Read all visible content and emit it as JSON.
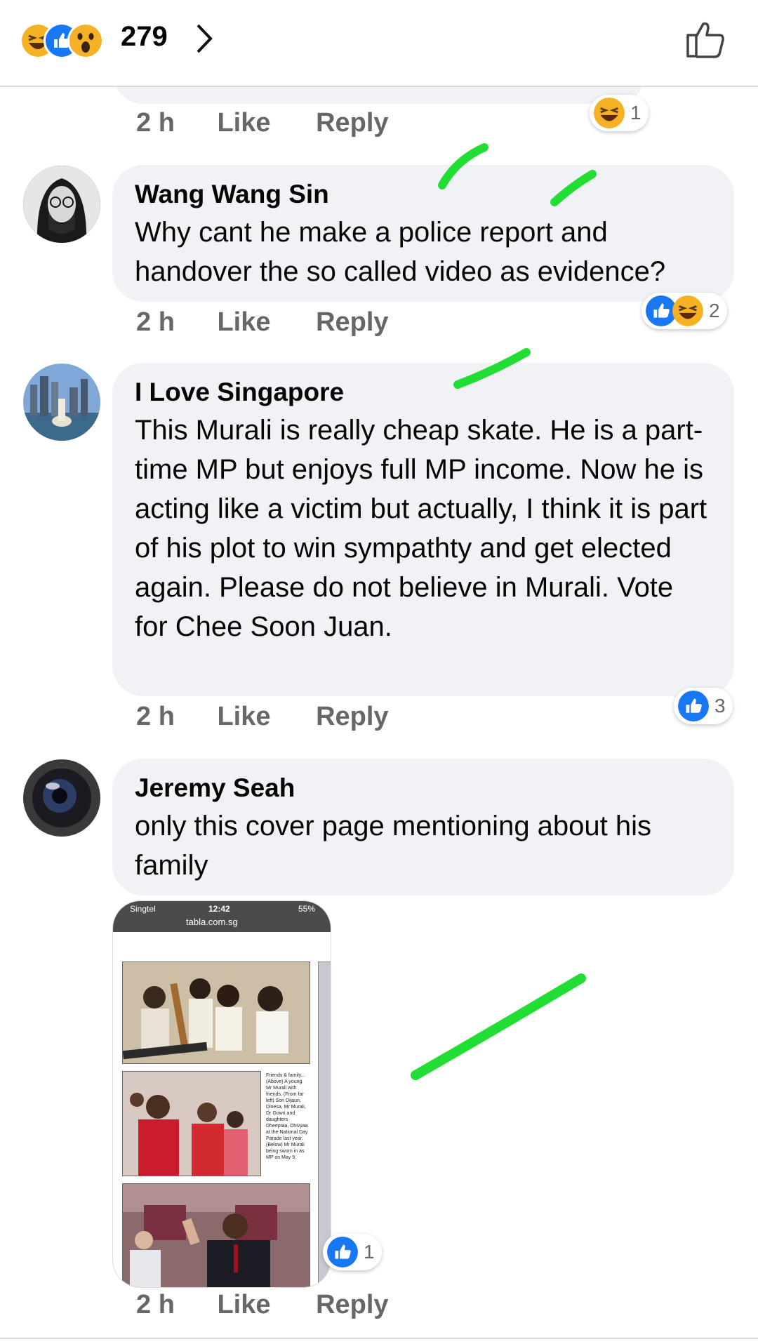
{
  "header": {
    "reaction_count": "279",
    "reactions": [
      "haha-icon",
      "like-icon",
      "wow-icon"
    ]
  },
  "comments": [
    {
      "id": "prev",
      "time": "2 h",
      "like": "Like",
      "reply": "Reply",
      "reaction_count": "1"
    },
    {
      "id": "wang",
      "author": "Wang Wang Sin",
      "text": "Why cant he make a police report and handover the so called video as evidence?",
      "time": "2 h",
      "like": "Like",
      "reply": "Reply",
      "reaction_count": "2"
    },
    {
      "id": "ilovesg",
      "author": "I Love Singapore",
      "text": "This Murali is really cheap skate. He is a part-time MP but enjoys full MP income. Now he is acting like a victim but actually, I think it is part of his plot to win sympathty and get elected again. Please do not believe in Murali. Vote for Chee Soon Juan.",
      "time": "2 h",
      "like": "Like",
      "reply": "Reply",
      "reaction_count": "3"
    },
    {
      "id": "jeremy",
      "author": "Jeremy Seah",
      "text": "only this cover page mentioning about his family",
      "time": "2 h",
      "like": "Like",
      "reply": "Reply",
      "reaction_count": "1",
      "attachment": {
        "carrier": "Singtel",
        "time": "12:42",
        "battery": "55%",
        "url": "tabla.com.sg",
        "caption": "Friends & family... (Above) A young Mr Murali with friends. (From far left) Son Dijaun, Dinesa, Mr Murali, Dr Gowri and daughters Dheeptaa, Dhivyaa at the National Day Parade last year. (Below) Mr Murali being sworn in as MP on May 9."
      }
    }
  ],
  "colors": {
    "bubble": "#f0f2f5",
    "meta": "#65676b",
    "like_blue": "#1877f2",
    "check_green": "#22dd33"
  }
}
